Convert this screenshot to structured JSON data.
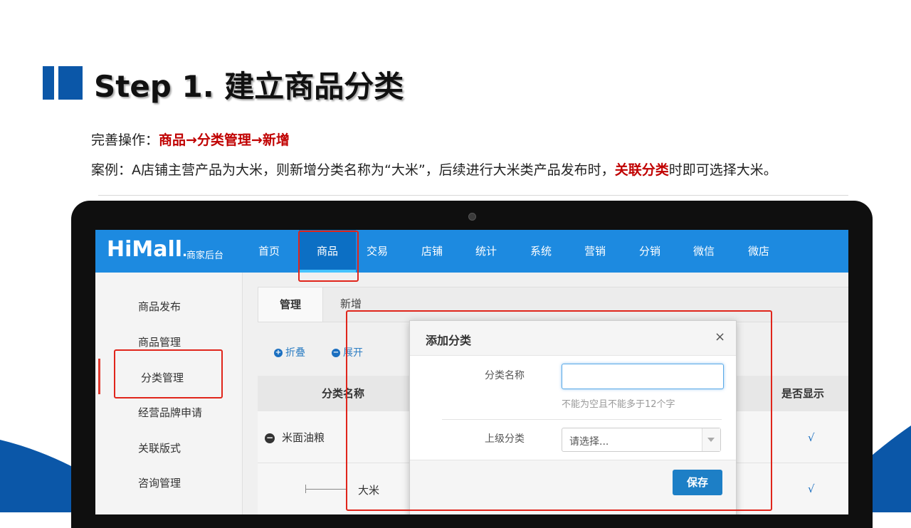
{
  "slide": {
    "title": "Step 1. 建立商品分类",
    "line1_prefix": "完善操作：",
    "line1_highlight": "商品→分类管理→新增",
    "line2_prefix": "案例：A店铺主营产品为大米，则新增分类名称为“大米”，后续进行大米类产品发布时，",
    "line2_highlight": "关联分类",
    "line2_suffix": "时即可选择大米。"
  },
  "app": {
    "logo": "HiMall",
    "logo_dot": ".",
    "logo_sub": "商家后台",
    "nav": [
      "首页",
      "商品",
      "交易",
      "店铺",
      "统计",
      "系统",
      "营销",
      "分销",
      "微信",
      "微店"
    ],
    "active_nav": "商品"
  },
  "sidebar": {
    "items": [
      "商品发布",
      "商品管理",
      "分类管理",
      "经营品牌申请",
      "关联版式",
      "咨询管理"
    ],
    "active": "分类管理"
  },
  "main": {
    "tabs": [
      "管理",
      "新增"
    ],
    "tools": [
      "折叠",
      "展开"
    ],
    "columns": [
      "分类名称",
      "是否显示"
    ],
    "rows": [
      {
        "name": "米面油粮",
        "visible": "√"
      },
      {
        "name": "大米",
        "visible": "√"
      }
    ]
  },
  "modal": {
    "title": "添加分类",
    "close": "×",
    "name_label": "分类名称",
    "name_value": "",
    "name_hint": "不能为空且不能多于12个字",
    "parent_label": "上级分类",
    "parent_placeholder": "请选择...",
    "save": "保存"
  },
  "colors": {
    "brand_blue": "#1d8ae0",
    "highlight_red": "#c00000",
    "title_bar": "#0b57a8"
  }
}
